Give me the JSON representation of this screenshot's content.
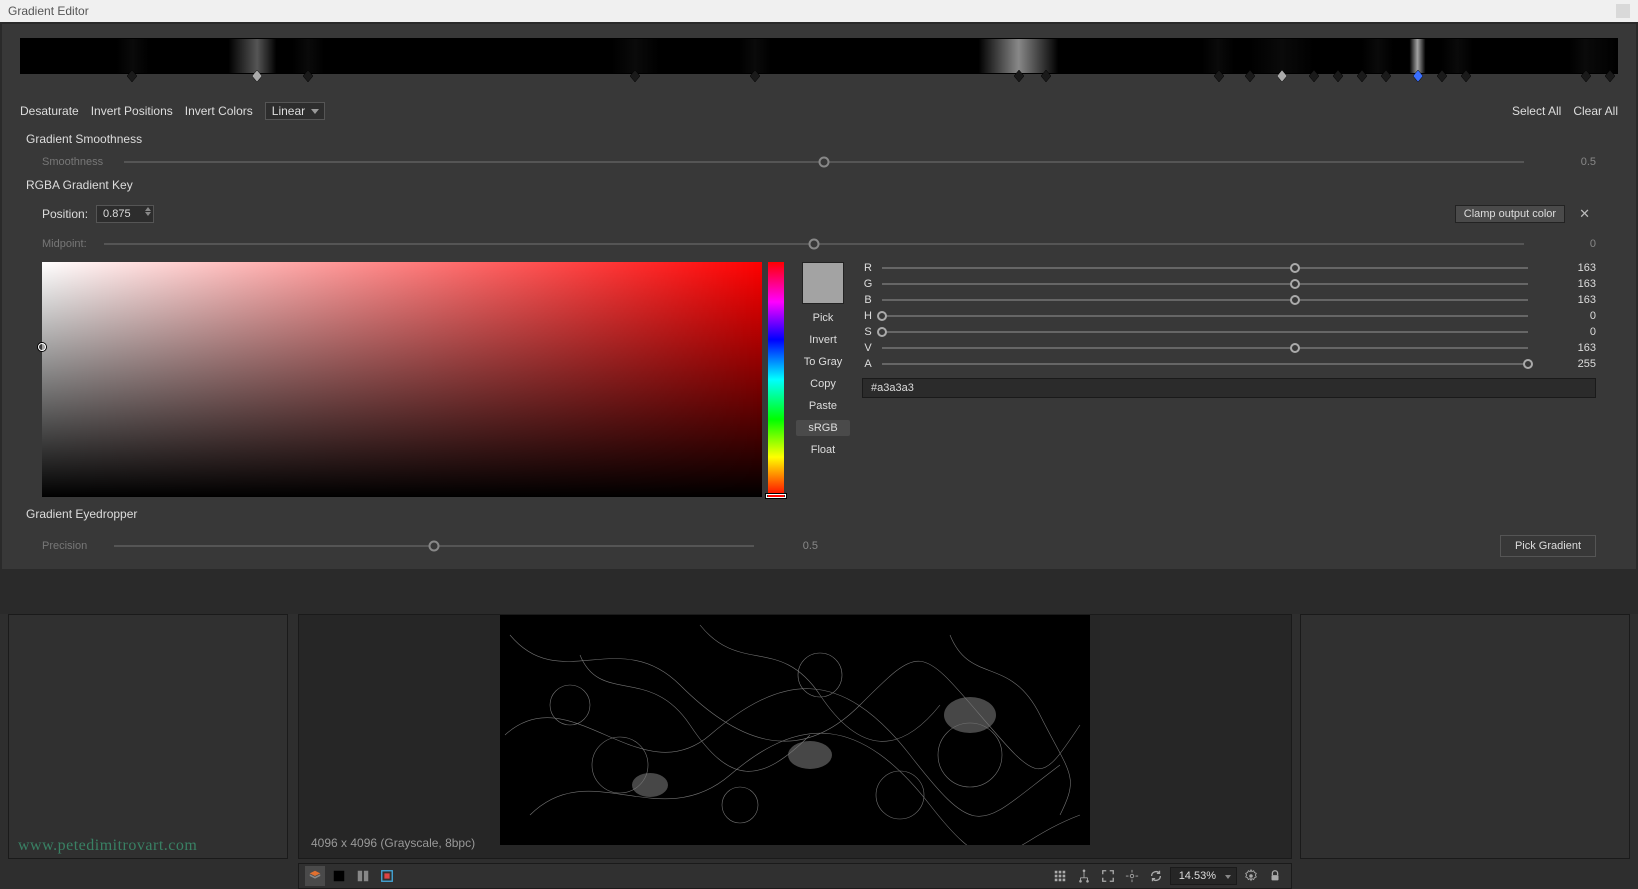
{
  "window": {
    "title": "Gradient Editor"
  },
  "toolbar": {
    "desaturate": "Desaturate",
    "invert_positions": "Invert Positions",
    "invert_colors": "Invert Colors",
    "interp_selected": "Linear",
    "select_all": "Select All",
    "clear_all": "Clear All"
  },
  "gradient_stops": [
    {
      "pos": 7.0,
      "sel": false
    },
    {
      "pos": 14.8,
      "sel": true
    },
    {
      "pos": 18.0,
      "sel": false
    },
    {
      "pos": 38.5,
      "sel": false
    },
    {
      "pos": 46.0,
      "sel": false
    },
    {
      "pos": 62.5,
      "sel": false
    },
    {
      "pos": 64.2,
      "sel": false
    },
    {
      "pos": 75.0,
      "sel": false
    },
    {
      "pos": 77.0,
      "sel": false
    },
    {
      "pos": 79.0,
      "sel": true
    },
    {
      "pos": 81.0,
      "sel": false
    },
    {
      "pos": 82.5,
      "sel": false
    },
    {
      "pos": 84.0,
      "sel": false
    },
    {
      "pos": 85.5,
      "sel": false
    },
    {
      "pos": 87.5,
      "sel": true,
      "color": "#3a6fff"
    },
    {
      "pos": 89.0,
      "sel": false
    },
    {
      "pos": 90.5,
      "sel": false
    },
    {
      "pos": 98.0,
      "sel": false
    },
    {
      "pos": 99.5,
      "sel": false
    }
  ],
  "smoothness": {
    "heading": "Gradient Smoothness",
    "label": "Smoothness",
    "value": "0.5",
    "pct": 50
  },
  "rgba_key": {
    "heading": "RGBA Gradient Key",
    "position_label": "Position:",
    "position_value": "0.875",
    "clamp_label": "Clamp output color",
    "midpoint_label": "Midpoint:",
    "midpoint_value": "0",
    "midpoint_pct": 50
  },
  "swatch_buttons": {
    "pick": "Pick",
    "invert": "Invert",
    "togray": "To Gray",
    "copy": "Copy",
    "paste": "Paste",
    "srgb": "sRGB",
    "float": "Float"
  },
  "channels": {
    "R": {
      "val": "163",
      "pct": 63.9
    },
    "G": {
      "val": "163",
      "pct": 63.9
    },
    "B": {
      "val": "163",
      "pct": 63.9
    },
    "H": {
      "val": "0",
      "pct": 0
    },
    "S": {
      "val": "0",
      "pct": 0
    },
    "V": {
      "val": "163",
      "pct": 63.9
    },
    "A": {
      "val": "255",
      "pct": 100
    }
  },
  "hex": "#a3a3a3",
  "swatch_color": "#a3a3a3",
  "eyedropper": {
    "heading": "Gradient Eyedropper",
    "precision_label": "Precision",
    "precision_value": "0.5",
    "precision_pct": 50,
    "pick_btn": "Pick Gradient"
  },
  "canvas": {
    "info": "4096 x 4096 (Grayscale, 8bpc)",
    "zoom": "14.53%"
  },
  "watermark": "www.petedimitrovart.com"
}
